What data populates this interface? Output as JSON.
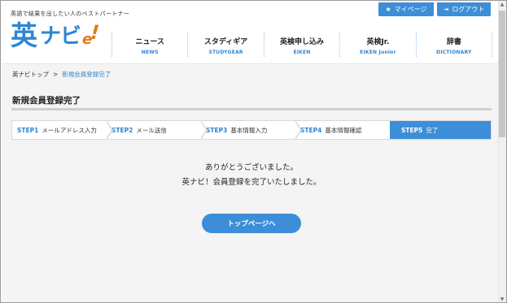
{
  "header": {
    "tagline": "英語で結果を出したい人のベストパートナー",
    "logo": {
      "ei": "英",
      "navi": "ナビ",
      "e": "e",
      "bang": "!"
    },
    "mypage_label": "マイページ",
    "logout_label": "ログアウト"
  },
  "nav": [
    {
      "jp": "ニュース",
      "en": "NEWS"
    },
    {
      "jp": "スタディギア",
      "en": "STUDYGEAR"
    },
    {
      "jp": "英検申し込み",
      "en": "EIKEN"
    },
    {
      "jp": "英検Jr.",
      "en": "EIKEN Junior"
    },
    {
      "jp": "辞書",
      "en": "DICTIONARY"
    }
  ],
  "breadcrumb": {
    "home": "英ナビトップ",
    "separator": ">",
    "current": "新規会員登録完了"
  },
  "page_title": "新規会員登録完了",
  "steps": [
    {
      "num": "STEP1",
      "label": "メールアドレス入力",
      "active": false
    },
    {
      "num": "STEP2",
      "label": "メール送信",
      "active": false
    },
    {
      "num": "STEP3",
      "label": "基本情報入力",
      "active": false
    },
    {
      "num": "STEP4",
      "label": "基本情報確認",
      "active": false
    },
    {
      "num": "STEP5",
      "label": "完了",
      "active": true
    }
  ],
  "message": {
    "line1": "ありがとうございました。",
    "line2": "英ナビ！会員登録を完了いたしました。"
  },
  "top_page_button_label": "トップページへ",
  "colors": {
    "accent": "#3d8ed8",
    "logo_orange": "#e07b1a",
    "background": "#f4f4f4"
  }
}
